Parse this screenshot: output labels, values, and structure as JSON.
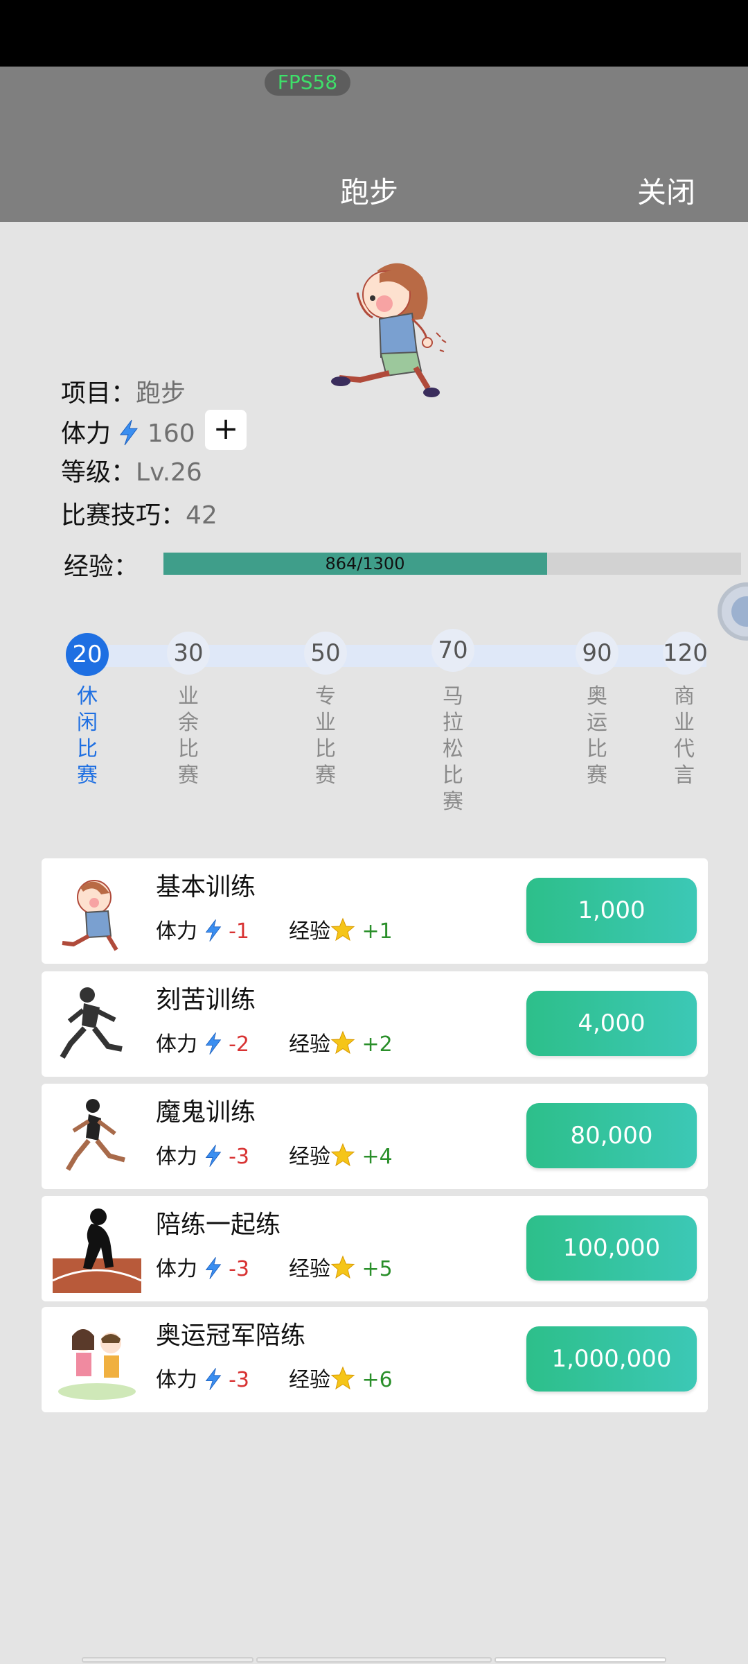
{
  "fps": "FPS58",
  "header": {
    "title": "跑步",
    "close_label": "关闭"
  },
  "info": {
    "project_label": "项目：",
    "project_value": "跑步",
    "stamina_label": "体力",
    "stamina_value": "160",
    "plus_label": "+",
    "level_label": "等级：",
    "level_value": "Lv.26",
    "skill_label": "比赛技巧：",
    "skill_value": "42"
  },
  "exp": {
    "label": "经验：",
    "text": "864/1300",
    "current": 864,
    "max": 1300
  },
  "milestones": [
    {
      "value": "20",
      "label": "休闲比赛",
      "active": true
    },
    {
      "value": "30",
      "label": "业余比赛",
      "active": false
    },
    {
      "value": "50",
      "label": "专业比赛",
      "active": false
    },
    {
      "value": "70",
      "label": "马拉松比赛",
      "active": false
    },
    {
      "value": "90",
      "label": "奥运比赛",
      "active": false
    },
    {
      "value": "120",
      "label": "商业代言",
      "active": false
    }
  ],
  "trainings": [
    {
      "name": "基本训练",
      "stamina_label": "体力",
      "stamina": "-1",
      "exp_label": "经验",
      "exp": "+1",
      "price": "1,000"
    },
    {
      "name": "刻苦训练",
      "stamina_label": "体力",
      "stamina": "-2",
      "exp_label": "经验",
      "exp": "+2",
      "price": "4,000"
    },
    {
      "name": "魔鬼训练",
      "stamina_label": "体力",
      "stamina": "-3",
      "exp_label": "经验",
      "exp": "+4",
      "price": "80,000"
    },
    {
      "name": "陪练一起练",
      "stamina_label": "体力",
      "stamina": "-3",
      "exp_label": "经验",
      "exp": "+5",
      "price": "100,000"
    },
    {
      "name": "奥运冠军陪练",
      "stamina_label": "体力",
      "stamina": "-3",
      "exp_label": "经验",
      "exp": "+6",
      "price": "1,000,000"
    }
  ],
  "colors": {
    "accent": "#1e6fe2",
    "button": "#2dbf8a",
    "exp_fill": "#3f9e8a",
    "negative": "#d83232",
    "positive": "#2a8f2a"
  },
  "icons": {
    "stamina": "lightning-bolt-icon",
    "exp": "star-icon"
  }
}
